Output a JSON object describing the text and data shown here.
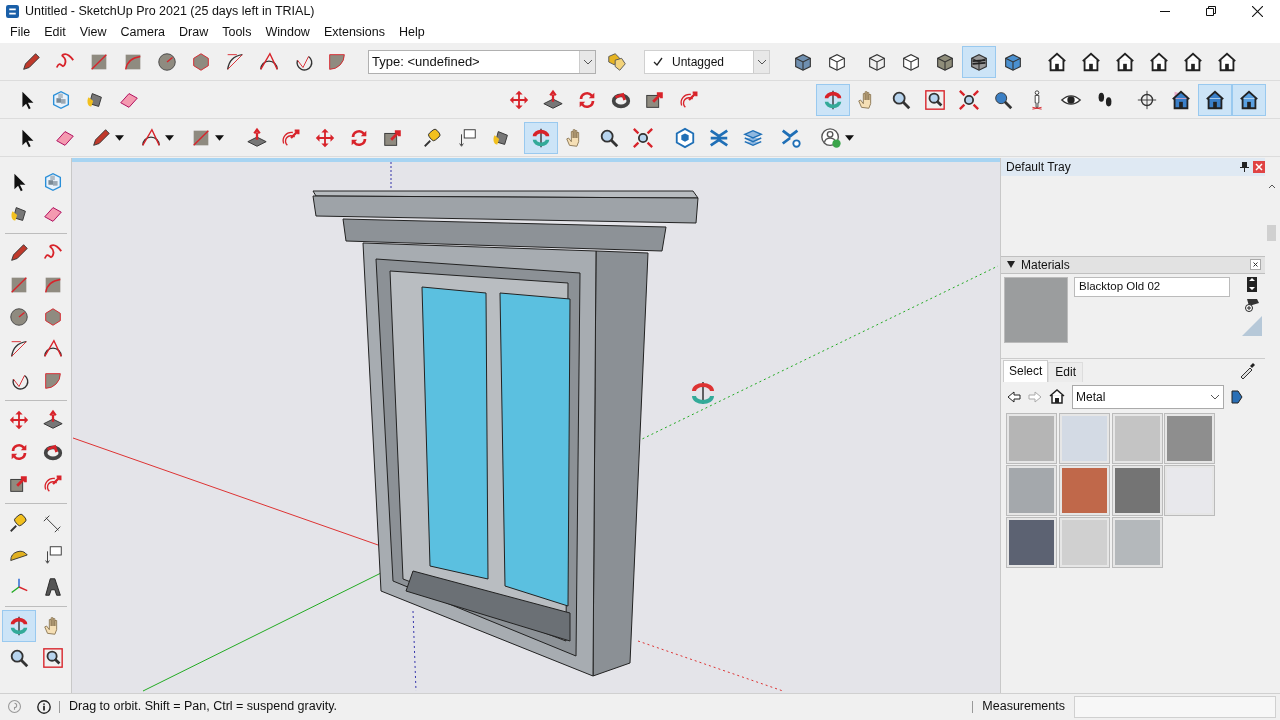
{
  "window": {
    "title": "Untitled - SketchUp Pro 2021 (25 days left in TRIAL)"
  },
  "menu": [
    "File",
    "Edit",
    "View",
    "Camera",
    "Draw",
    "Tools",
    "Window",
    "Extensions",
    "Help"
  ],
  "toolbar_rows": [
    {
      "groups": [
        {
          "items": [
            {
              "kind": "pencil",
              "selected": false
            },
            {
              "kind": "freehand",
              "selected": false
            },
            {
              "kind": "rect",
              "selected": false
            },
            {
              "kind": "rotrect",
              "selected": false
            },
            {
              "kind": "circle",
              "selected": false
            },
            {
              "kind": "polygon",
              "selected": false
            },
            {
              "kind": "arc",
              "selected": false
            },
            {
              "kind": "arc2",
              "selected": false
            },
            {
              "kind": "arc3",
              "selected": false
            },
            {
              "kind": "pie",
              "selected": false
            }
          ]
        },
        {
          "items": [
            {
              "kind": "type_dropdown",
              "value": "Type: <undefined>"
            },
            {
              "kind": "tag",
              "selected": false
            }
          ]
        },
        {
          "items": [
            {
              "kind": "tag_dropdown",
              "value": "Untagged",
              "checked": true
            }
          ]
        },
        {
          "items": [
            {
              "kind": "xray",
              "selected": false
            },
            {
              "kind": "backedges",
              "selected": false
            }
          ]
        },
        {
          "items": [
            {
              "kind": "wireframe",
              "selected": false
            },
            {
              "kind": "hiddenline",
              "selected": false
            },
            {
              "kind": "shaded",
              "selected": false
            },
            {
              "kind": "textured",
              "selected": true
            },
            {
              "kind": "monochrome",
              "selected": false
            }
          ]
        },
        {
          "items": [
            {
              "kind": "house",
              "selected": false
            },
            {
              "kind": "house",
              "selected": false
            },
            {
              "kind": "house",
              "selected": false
            },
            {
              "kind": "house",
              "selected": false
            },
            {
              "kind": "house",
              "selected": false
            },
            {
              "kind": "house",
              "selected": false
            }
          ]
        }
      ]
    },
    {
      "groups": [
        {
          "items": [
            {
              "kind": "select",
              "selected": false
            },
            {
              "kind": "component",
              "selected": false
            },
            {
              "kind": "paint",
              "selected": false
            },
            {
              "kind": "eraser",
              "selected": false
            }
          ]
        },
        {
          "items": [
            {
              "kind": "move",
              "selected": false
            },
            {
              "kind": "pushpull",
              "selected": false
            },
            {
              "kind": "rotate",
              "selected": false
            },
            {
              "kind": "followme",
              "selected": false
            },
            {
              "kind": "scale",
              "selected": false
            },
            {
              "kind": "offset",
              "selected": false
            }
          ]
        },
        {
          "items": [
            {
              "kind": "orbit",
              "selected": true
            },
            {
              "kind": "pan",
              "selected": false
            },
            {
              "kind": "zoom",
              "selected": false
            },
            {
              "kind": "zoomwindow",
              "selected": false
            },
            {
              "kind": "zoomext",
              "selected": false
            },
            {
              "kind": "previous",
              "selected": false
            },
            {
              "kind": "position",
              "selected": false
            },
            {
              "kind": "lookaround",
              "selected": false
            },
            {
              "kind": "walk",
              "selected": false
            }
          ]
        },
        {
          "items": [
            {
              "kind": "section",
              "selected": false
            },
            {
              "kind": "sectionplane",
              "selected": false
            },
            {
              "kind": "sectioncut",
              "selected": true
            },
            {
              "kind": "sectionfill",
              "selected": true
            }
          ]
        }
      ]
    },
    {
      "groups": [
        {
          "items": [
            {
              "kind": "select",
              "selected": false
            }
          ]
        },
        {
          "items": [
            {
              "kind": "eraser",
              "selected": false
            },
            {
              "kind": "pencil",
              "selected": false,
              "caret": true
            },
            {
              "kind": "arc2",
              "selected": false,
              "caret": true
            },
            {
              "kind": "rect",
              "selected": false,
              "caret": true
            }
          ]
        },
        {
          "items": [
            {
              "kind": "pushpull",
              "selected": false
            },
            {
              "kind": "offset",
              "selected": false
            },
            {
              "kind": "move",
              "selected": false
            },
            {
              "kind": "rotate",
              "selected": false
            },
            {
              "kind": "scale",
              "selected": false
            }
          ]
        },
        {
          "items": [
            {
              "kind": "tape",
              "selected": false
            },
            {
              "kind": "text",
              "selected": false
            },
            {
              "kind": "paint",
              "selected": false
            }
          ]
        },
        {
          "items": [
            {
              "kind": "orbit",
              "selected": true
            },
            {
              "kind": "pan",
              "selected": false
            },
            {
              "kind": "zoom",
              "selected": false
            },
            {
              "kind": "zoomext",
              "selected": false
            }
          ]
        },
        {
          "items": [
            {
              "kind": "warehouse",
              "selected": false
            },
            {
              "kind": "extwarehouse",
              "selected": false
            },
            {
              "kind": "layout",
              "selected": false
            }
          ]
        },
        {
          "items": [
            {
              "kind": "extmanager",
              "selected": false
            }
          ]
        },
        {
          "items": [
            {
              "kind": "profile",
              "selected": false,
              "caret": true
            }
          ]
        }
      ]
    }
  ],
  "left_toolbar": {
    "groups": [
      {
        "items": [
          {
            "kind": "select",
            "selected": false
          },
          {
            "kind": "component",
            "selected": false
          },
          {
            "kind": "paint",
            "selected": false
          },
          {
            "kind": "eraser",
            "selected": false
          }
        ]
      },
      {
        "items": [
          {
            "kind": "pencil",
            "selected": false
          },
          {
            "kind": "freehand",
            "selected": false
          },
          {
            "kind": "rect",
            "selected": false
          },
          {
            "kind": "rotrect",
            "selected": false
          },
          {
            "kind": "circle",
            "selected": false
          },
          {
            "kind": "polygon",
            "selected": false
          },
          {
            "kind": "arc",
            "selected": false
          },
          {
            "kind": "arc2",
            "selected": false
          },
          {
            "kind": "arc3",
            "selected": false
          },
          {
            "kind": "pie",
            "selected": false
          }
        ]
      },
      {
        "items": [
          {
            "kind": "move",
            "selected": false
          },
          {
            "kind": "pushpull",
            "selected": false
          },
          {
            "kind": "rotate",
            "selected": false
          },
          {
            "kind": "followme",
            "selected": false
          },
          {
            "kind": "scale",
            "selected": false
          },
          {
            "kind": "offset",
            "selected": false
          }
        ]
      },
      {
        "items": [
          {
            "kind": "tape",
            "selected": false
          },
          {
            "kind": "dimension",
            "selected": false
          },
          {
            "kind": "protractor",
            "selected": false
          },
          {
            "kind": "text",
            "selected": false
          },
          {
            "kind": "axes",
            "selected": false
          },
          {
            "kind": "text3d",
            "selected": false
          }
        ]
      },
      {
        "items": [
          {
            "kind": "orbit",
            "selected": true
          },
          {
            "kind": "pan",
            "selected": false
          },
          {
            "kind": "zoom",
            "selected": false
          },
          {
            "kind": "zoomwindow",
            "selected": false
          }
        ]
      }
    ]
  },
  "tray": {
    "title": "Default Tray",
    "materials": {
      "title": "Materials",
      "expanded": true,
      "name": "Blacktop Old 02",
      "tabs": [
        {
          "label": "Select",
          "selected": true
        },
        {
          "label": "Edit",
          "selected": false
        }
      ],
      "collection": "Metal",
      "swatches": [
        {
          "color": "#b5b5b5"
        },
        {
          "color": "#d3dae4"
        },
        {
          "color": "#c4c4c4"
        },
        {
          "color": "#8e8e8e"
        },
        {
          "color": "#a4a8ac"
        },
        {
          "color": "#c0684a"
        },
        {
          "color": "#747474"
        },
        {
          "color": "#e8e8ec"
        },
        {
          "color": "#5c6272"
        },
        {
          "color": "#d0d0d0"
        },
        {
          "color": "#b4b8bb"
        }
      ]
    }
  },
  "status_bar": {
    "message": "Drag to orbit. Shift = Pan, Ctrl = suspend gravity.",
    "measurements_label": "Measurements"
  }
}
